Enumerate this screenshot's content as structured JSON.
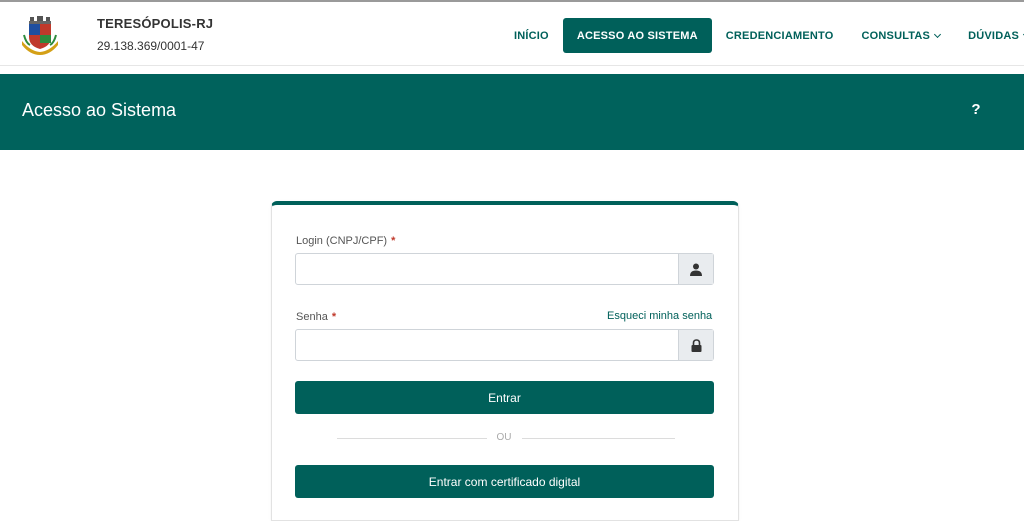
{
  "header": {
    "org_name": "TERESÓPOLIS-RJ",
    "cnpj": "29.138.369/0001-47",
    "nav": {
      "inicio": "INÍCIO",
      "acesso": "ACESSO AO SISTEMA",
      "credenciamento": "CREDENCIAMENTO",
      "consultas": "CONSULTAS",
      "duvidas": "DÚVIDAS"
    }
  },
  "banner": {
    "title": "Acesso ao Sistema",
    "help": "?"
  },
  "form": {
    "login_label": "Login (CNPJ/CPF)",
    "senha_label": "Senha",
    "required_mark": "*",
    "forgot_label": "Esqueci minha senha",
    "login_value": "",
    "senha_value": "",
    "entrar_label": "Entrar",
    "divider_label": "OU",
    "certificado_label": "Entrar com certificado digital"
  },
  "colors": {
    "brand": "#00605a",
    "banner": "#00625c",
    "required": "#c0392b"
  },
  "icons": {
    "crest": "municipal-crest-icon",
    "user": "user-icon",
    "lock": "lock-icon",
    "chevron": "chevron-down-icon",
    "help": "help-icon"
  }
}
